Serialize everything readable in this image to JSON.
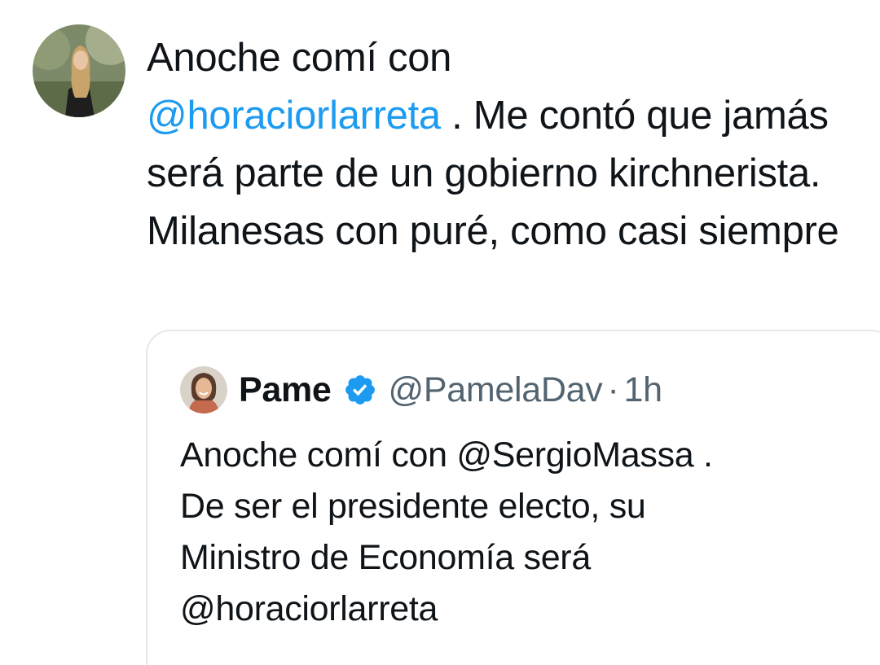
{
  "tweet": {
    "text_part1": "Anoche comí con",
    "mention": "@horaciorlarreta",
    "text_part2": " . Me contó que jamás será parte de un gobierno kirchnerista. Milanesas con puré, como casi siempre"
  },
  "quote": {
    "name": "Pame",
    "handle": "@PamelaDav",
    "separator": "·",
    "time": "1h",
    "text_line1": "Anoche comí con @SergioMassa .",
    "text_line2": "De ser el presidente electo, su",
    "text_line3": "Ministro de Economía será",
    "text_line4": "@horaciorlarreta"
  },
  "colors": {
    "mention": "#1d9bf0",
    "verified": "#1d9bf0",
    "secondary_text": "#536471",
    "card_border": "#e4e8eb"
  },
  "icons": {
    "verified": "verified-badge-icon"
  }
}
